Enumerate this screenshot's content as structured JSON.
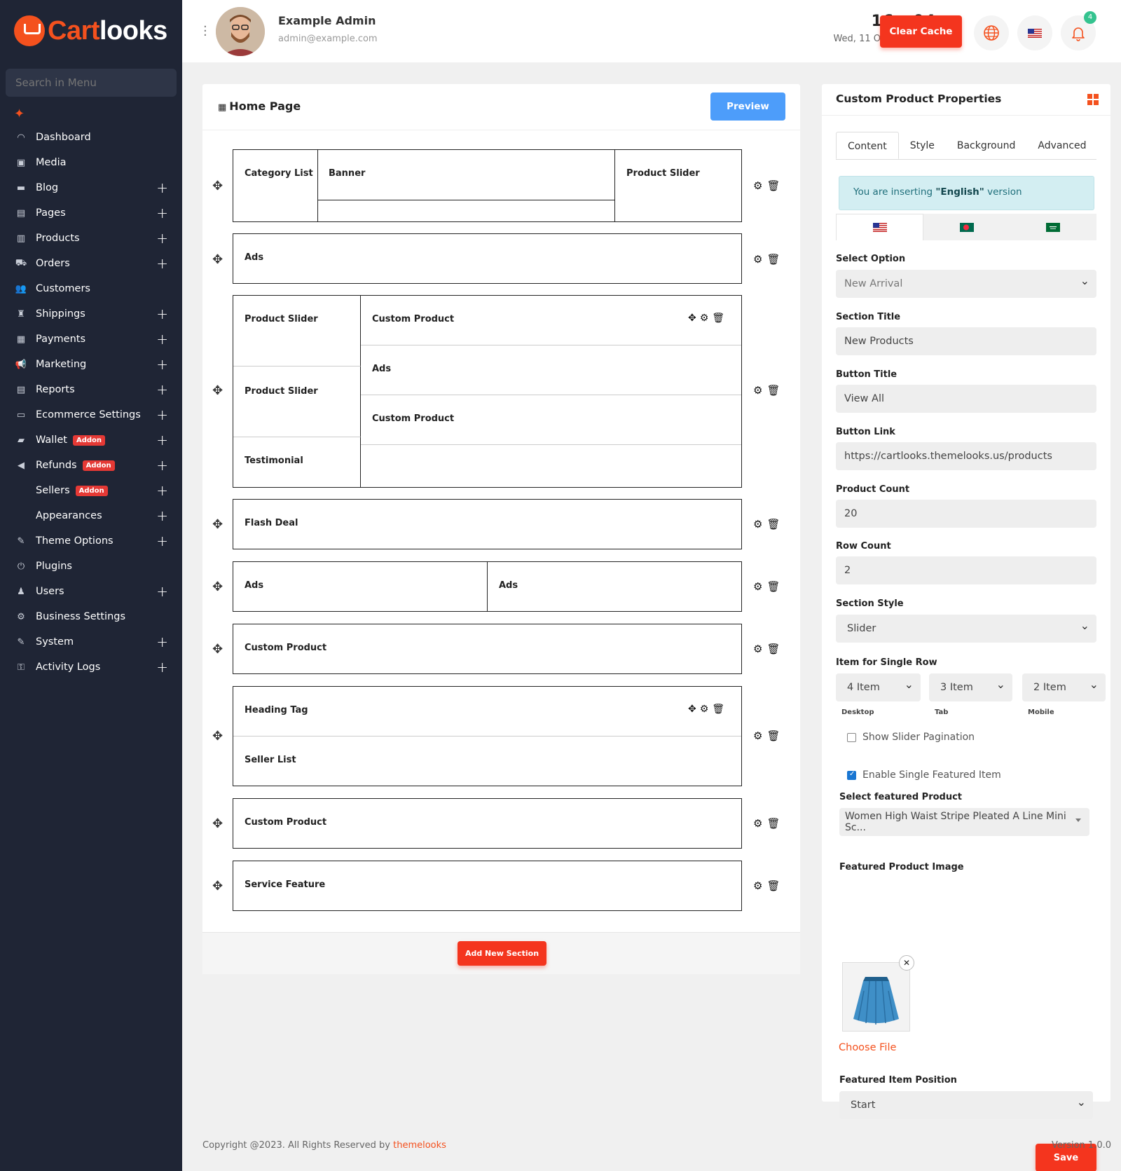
{
  "brand": {
    "part1": "Cart",
    "part2": "looks",
    "accent": "#f4511e"
  },
  "sidebar": {
    "search_placeholder": "Search in Menu",
    "items": [
      {
        "label": "Dashboard",
        "icon": "gauge-icon",
        "expand": false
      },
      {
        "label": "Media",
        "icon": "media-icon",
        "expand": false
      },
      {
        "label": "Blog",
        "icon": "blog-icon",
        "expand": true
      },
      {
        "label": "Pages",
        "icon": "pages-icon",
        "expand": true
      },
      {
        "label": "Products",
        "icon": "products-icon",
        "expand": true
      },
      {
        "label": "Orders",
        "icon": "cart-icon",
        "expand": true
      },
      {
        "label": "Customers",
        "icon": "customers-icon",
        "expand": false
      },
      {
        "label": "Shippings",
        "icon": "shipping-icon",
        "expand": true
      },
      {
        "label": "Payments",
        "icon": "payments-icon",
        "expand": true
      },
      {
        "label": "Marketing",
        "icon": "megaphone-icon",
        "expand": true
      },
      {
        "label": "Reports",
        "icon": "reports-icon",
        "expand": true
      },
      {
        "label": "Ecommerce Settings",
        "icon": "ecommerce-settings-icon",
        "expand": true
      },
      {
        "label": "Wallet",
        "icon": "wallet-icon",
        "expand": true,
        "badge": "Addon"
      },
      {
        "label": "Refunds",
        "icon": "refunds-icon",
        "expand": true,
        "badge": "Addon"
      },
      {
        "label": "Sellers",
        "icon": "",
        "expand": true,
        "badge": "Addon"
      },
      {
        "label": "Appearances",
        "icon": "",
        "expand": true
      },
      {
        "label": "Theme Options",
        "icon": "theme-icon",
        "expand": true
      },
      {
        "label": "Plugins",
        "icon": "plugins-icon",
        "expand": false
      },
      {
        "label": "Users",
        "icon": "users-icon",
        "expand": true
      },
      {
        "label": "Business Settings",
        "icon": "business-settings-icon",
        "expand": false
      },
      {
        "label": "System",
        "icon": "system-icon",
        "expand": true
      },
      {
        "label": "Activity Logs",
        "icon": "key-icon",
        "expand": true
      }
    ]
  },
  "header": {
    "user_name": "Example Admin",
    "user_email": "admin@example.com",
    "time": "16 : 04",
    "date": "Wed, 11 October 2023",
    "clear_cache_label": "Clear Cache",
    "notification_count": "4"
  },
  "builder": {
    "title": "Home Page",
    "preview_label": "Preview",
    "add_section_label": "Add New Section",
    "sections": {
      "s1": [
        "Category List",
        "Banner",
        "Product Slider"
      ],
      "s2": "Ads",
      "s3_left": [
        "Product Slider",
        "Product Slider",
        "Testimonial"
      ],
      "s3_right": [
        "Custom Product",
        "Ads",
        "Custom Product"
      ],
      "s4": "Flash Deal",
      "s5": [
        "Ads",
        "Ads"
      ],
      "s6": "Custom Product",
      "s7": [
        "Heading Tag",
        "Seller List"
      ],
      "s8": "Custom Product",
      "s9": "Service Feature"
    }
  },
  "props": {
    "title": "Custom Product Properties",
    "tabs": [
      "Content",
      "Style",
      "Background",
      "Advanced"
    ],
    "alert_prefix": "You are inserting",
    "alert_lang": "\"English\"",
    "alert_suffix": "version",
    "select_option_label": "Select Option",
    "select_option_value": "New Arrival",
    "section_title_label": "Section Title",
    "section_title_value": "New Products",
    "button_title_label": "Button Title",
    "button_title_value": "View All",
    "button_link_label": "Button Link",
    "button_link_value": "https://cartlooks.themelooks.us/products",
    "product_count_label": "Product Count",
    "product_count_value": "20",
    "row_count_label": "Row Count",
    "row_count_value": "2",
    "section_style_label": "Section Style",
    "section_style_value": "Slider",
    "single_row_label": "Item for Single Row",
    "desktop_value": "4 Item",
    "tab_value": "3 Item",
    "mobile_value": "2 Item",
    "desktop_label": "Desktop",
    "tab_label": "Tab",
    "mobile_label": "Mobile",
    "show_pagination_label": "Show Slider Pagination",
    "show_pagination_checked": false,
    "enable_featured_label": "Enable Single Featured Item",
    "enable_featured_checked": true,
    "featured_product_label": "Select featured Product",
    "featured_product_value": "Women High Waist Stripe Pleated A Line Mini Sc...",
    "featured_image_label": "Featured Product Image",
    "choose_file_label": "Choose File",
    "featured_position_label": "Featured Item Position",
    "featured_position_value": "Start",
    "save_label": "Save"
  },
  "footer": {
    "copyright": "Copyright @2023. All Rights Reserved by",
    "link": "themelooks",
    "version": "Version 1.0.0"
  }
}
